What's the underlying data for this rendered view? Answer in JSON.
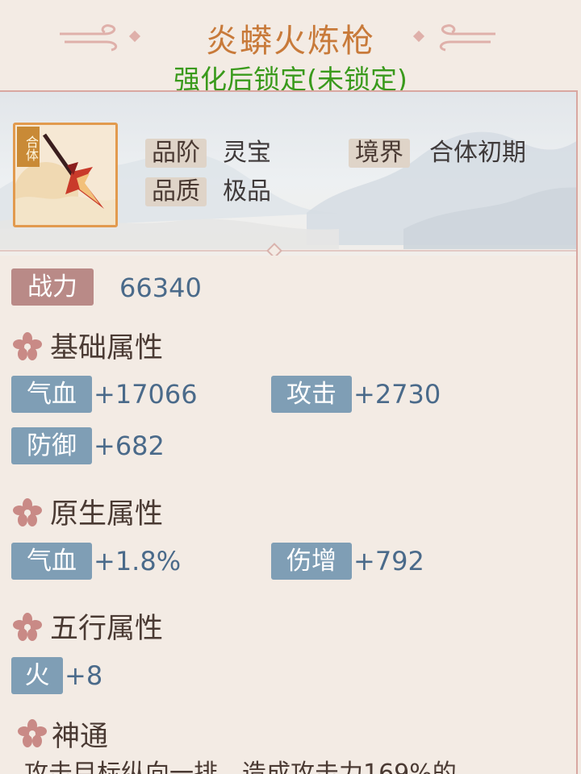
{
  "header": {
    "title": "炎蟒火炼枪",
    "subtitle": "强化后锁定(未锁定)"
  },
  "item": {
    "badge": "合体",
    "icon": "fire-spear-icon",
    "grade_label": "品阶",
    "grade_value": "灵宝",
    "quality_label": "品质",
    "quality_value": "极品",
    "realm_label": "境界",
    "realm_value": "合体初期"
  },
  "power": {
    "label": "战力",
    "value": "66340"
  },
  "basic": {
    "title": "基础属性",
    "attrs": [
      {
        "label": "气血",
        "value": "+17066"
      },
      {
        "label": "攻击",
        "value": "+2730"
      },
      {
        "label": "防御",
        "value": "+682"
      }
    ]
  },
  "native": {
    "title": "原生属性",
    "attrs": [
      {
        "label": "气血",
        "value": "+1.8%"
      },
      {
        "label": "伤增",
        "value": "+792"
      }
    ]
  },
  "five_elements": {
    "title": "五行属性",
    "attrs": [
      {
        "label": "火",
        "value": "+8"
      }
    ]
  },
  "skill": {
    "title": "神通",
    "description": "攻击目标纵向一排，造成攻击力169%的"
  },
  "colors": {
    "title": "#c87a3a",
    "subtitle": "#3a9a1c",
    "attr_label_bg": "#7f9eb5",
    "power_label_bg": "#b98a87",
    "value_text": "#4a6a8a",
    "flower": "#c98a86"
  }
}
